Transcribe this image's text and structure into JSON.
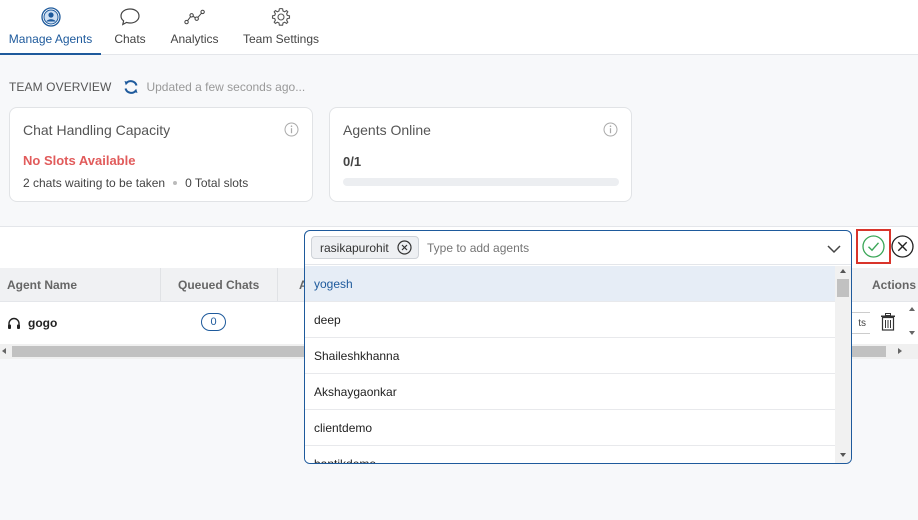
{
  "nav": {
    "tabs": [
      {
        "label": "Manage Agents",
        "icon": "user-circle-icon",
        "active": true
      },
      {
        "label": "Chats",
        "icon": "chat-bubble-icon"
      },
      {
        "label": "Analytics",
        "icon": "analytics-icon"
      },
      {
        "label": "Team Settings",
        "icon": "gear-icon"
      }
    ]
  },
  "overview": {
    "title": "TEAM OVERVIEW",
    "updated": "Updated a few seconds ago..."
  },
  "capacity_card": {
    "title": "Chat Handling Capacity",
    "status": "No Slots Available",
    "waiting": "2 chats waiting to be taken",
    "total": "0 Total slots"
  },
  "online_card": {
    "title": "Agents Online",
    "value": "0/1",
    "progress_fraction": 0
  },
  "table": {
    "headers": [
      "Agent Name",
      "Queued Chats",
      "A",
      "Actions"
    ],
    "rows": [
      {
        "agent": "gogo",
        "queued": "0",
        "action_label": "ts"
      }
    ]
  },
  "agent_picker": {
    "selected_chip": "rasikapurohit",
    "placeholder": "Type to add agents",
    "options": [
      "yogesh",
      "deep",
      "Shaileshkhanna",
      "Akshaygaonkar",
      "clientdemo",
      "bantikdemo"
    ],
    "highlighted_index": 0
  },
  "colors": {
    "accent": "#1e5a9c",
    "danger": "#e15b5b",
    "confirm_green": "#3aa657",
    "confirm_border": "#d9342b"
  }
}
